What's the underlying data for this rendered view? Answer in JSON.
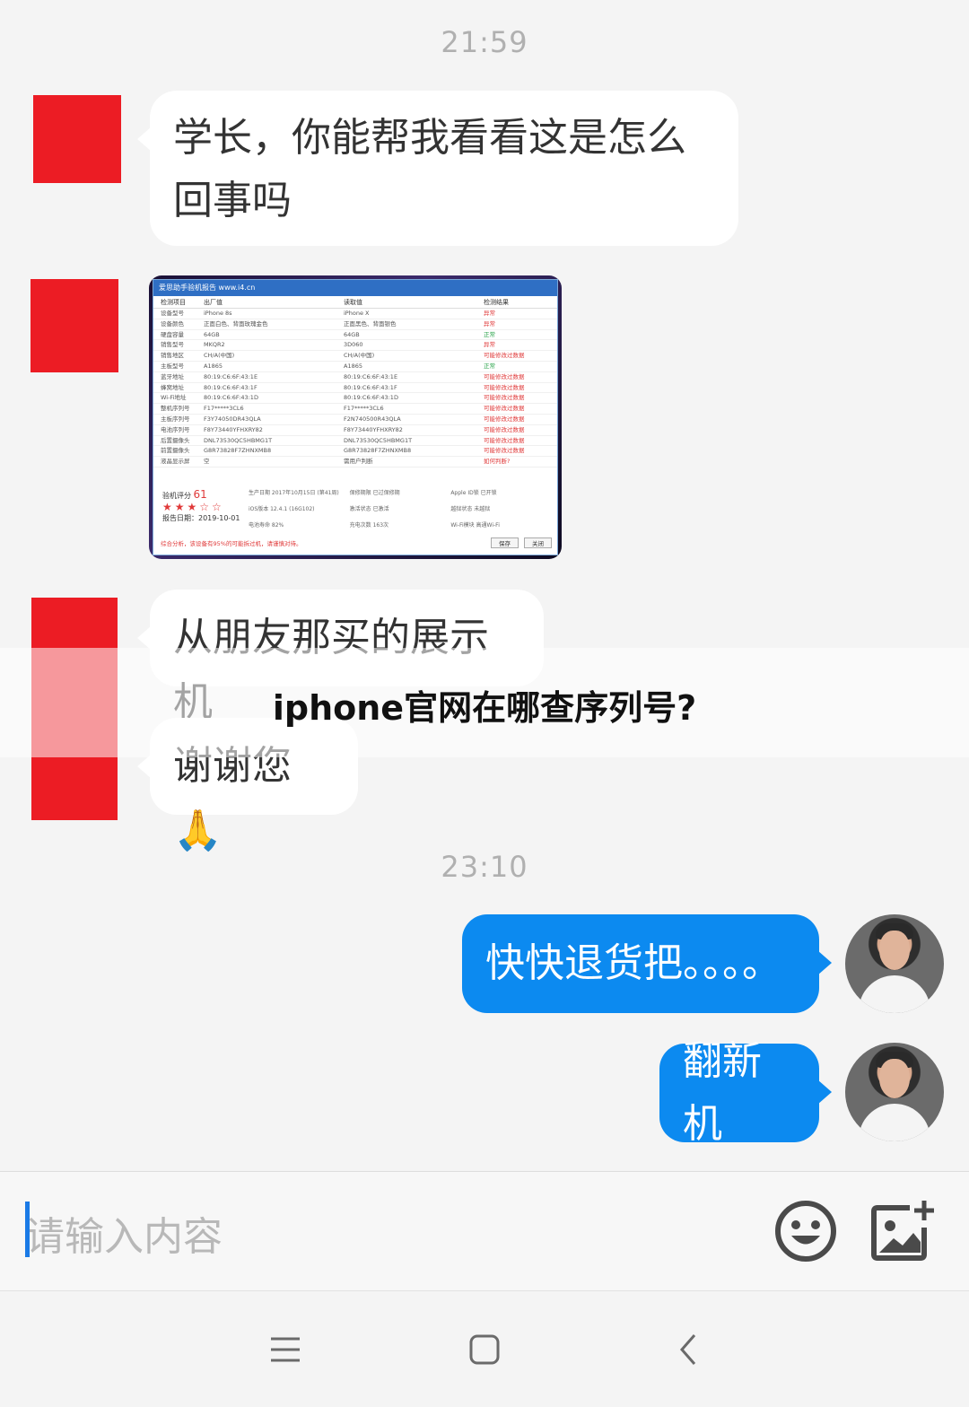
{
  "chat": {
    "timestamp_1": "21:59",
    "msg_1": "学长，你能帮我看看这是怎么回事吗",
    "msg_3": "从朋友那买的展示机",
    "msg_4": "谢谢您",
    "msg_4_emoji": "🙏",
    "timestamp_2": "23:10",
    "reply_1": "快快退货把。。。。",
    "reply_2": "翻新机"
  },
  "overlay": {
    "title": "iphone官网在哪查序列号?"
  },
  "screenshot": {
    "window_title": "爱思助手验机报告 www.i4.cn",
    "headers": [
      "检测项目",
      "出厂值",
      "读取值",
      "检测结果"
    ],
    "rows": [
      [
        "设备型号",
        "iPhone 8s",
        "iPhone X",
        "异常"
      ],
      [
        "设备颜色",
        "正面白色、背面玫瑰金色",
        "正面黑色、背面银色",
        "异常"
      ],
      [
        "硬盘容量",
        "64GB",
        "64GB",
        "正常"
      ],
      [
        "销售型号",
        "MKQR2",
        "3D060",
        "异常"
      ],
      [
        "销售地区",
        "CH/A(中国)",
        "CH/A(中国)",
        "可能修改过数据"
      ],
      [
        "主板型号",
        "A1865",
        "A1865",
        "正常"
      ],
      [
        "蓝牙地址",
        "80:19:C6:6F:43:1E",
        "80:19:C6:6F:43:1E",
        "可能修改过数据"
      ],
      [
        "蜂窝地址",
        "80:19:C6:6F:43:1F",
        "80:19:C6:6F:43:1F",
        "可能修改过数据"
      ],
      [
        "Wi-Fi地址",
        "80:19:C6:6F:43:1D",
        "80:19:C6:6F:43:1D",
        "可能修改过数据"
      ],
      [
        "整机序列号",
        "F17*****3CL6",
        "F17*****3CL6",
        "可能修改过数据"
      ],
      [
        "主板序列号",
        "F3Y74050DR43QLA",
        "F2N740500R43QLA",
        "可能修改过数据"
      ],
      [
        "电池序列号",
        "F8Y73440YFHXRY82",
        "F8Y73440YFHXRY82",
        "可能修改过数据"
      ],
      [
        "后置摄像头",
        "DNL73530QC5HBMG1T",
        "DNL73530QC5HBMG1T",
        "可能修改过数据"
      ],
      [
        "前置摄像头",
        "G8R73828F7ZHNXMB8",
        "G8R73828F7ZHNXMB8",
        "可能修改过数据"
      ],
      [
        "液晶显示屏",
        "空",
        "需用户判断",
        "如何判断?"
      ]
    ],
    "score_label": "验机评分",
    "score_value": "61",
    "stars": "★★★☆☆",
    "report_date": "报告日期：2019-10-01",
    "details": [
      "生产日期 2017年10月15日 (第41周)",
      "保修期限 已过保修期",
      "Apple ID锁 已开锁",
      "iOS版本 12.4.1 (16G102)",
      "激活状态 已激活",
      "越狱状态 未越狱",
      "电池寿命 82%",
      "充电次数 163次",
      "Wi-Fi模块 高通Wi-Fi"
    ],
    "warning": "综合分析，该设备有95%的可能拆过机，请谨慎对待。",
    "btn_save": "保存",
    "btn_close": "关闭"
  },
  "input": {
    "placeholder": "请输入内容"
  },
  "icons": {
    "emoji": "smiley-icon",
    "image": "image-add-icon",
    "menu": "menu-icon",
    "home": "home-icon",
    "back": "back-icon"
  },
  "colors": {
    "outgoing_bubble": "#0c8af0",
    "incoming_bubble": "#ffffff",
    "avatar_red": "#ec1c24",
    "background": "#f4f4f4"
  }
}
